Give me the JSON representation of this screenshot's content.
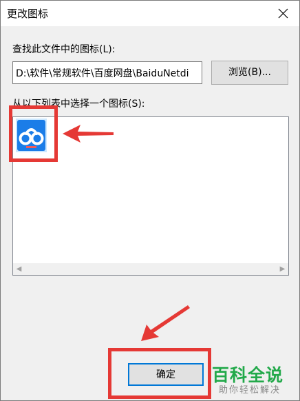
{
  "window": {
    "title": "更改图标"
  },
  "file_section": {
    "label": "查找此文件中的图标(L):",
    "path_value": "D:\\软件\\常规软件\\百度网盘\\BaiduNetdi",
    "browse_label": "浏览(B)..."
  },
  "icon_section": {
    "label": "从以下列表中选择一个图标(S):",
    "icons": [
      {
        "name": "baidu-netdisk-icon",
        "selected": true
      }
    ]
  },
  "footer": {
    "ok_label": "确定"
  },
  "annotation": {
    "color": "#e53935"
  },
  "watermark": {
    "title": "百科全说",
    "subtitle": "助你轻松解决"
  }
}
